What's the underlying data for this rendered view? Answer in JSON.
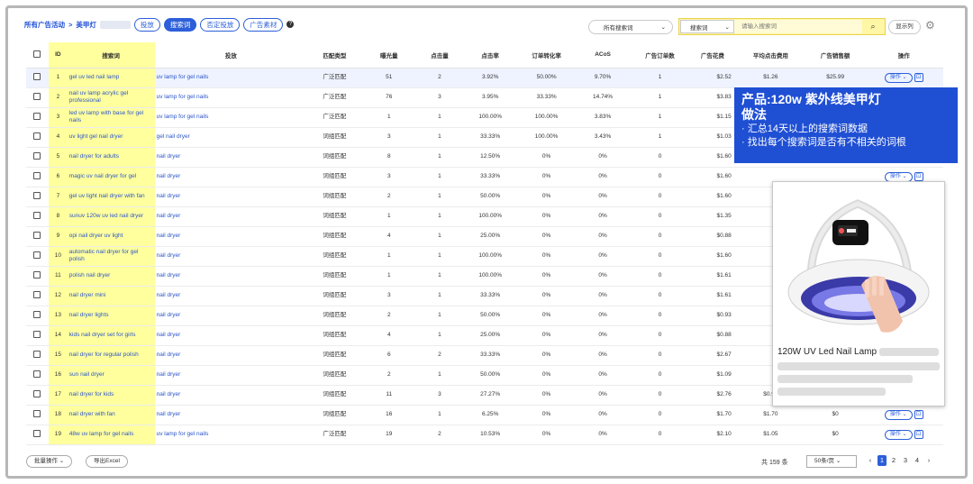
{
  "breadcrumb": {
    "campaigns": "所有广告活动",
    "separator": ">",
    "product": "美甲灯"
  },
  "tabs": [
    {
      "label": "投放",
      "active": false
    },
    {
      "label": "搜索词",
      "active": true
    },
    {
      "label": "否定投放",
      "active": false
    },
    {
      "label": "广告素材",
      "active": false
    }
  ],
  "filter": {
    "search_scope": "所有搜索词"
  },
  "search": {
    "type": "搜索词",
    "placeholder": "请输入搜索词"
  },
  "toolbar": {
    "display_columns": "显示列"
  },
  "table": {
    "headers": [
      "ID",
      "搜索词",
      "投放",
      "匹配类型",
      "曝光量",
      "点击量",
      "点击率",
      "订单转化率",
      "ACoS",
      "广告订单数",
      "广告花费",
      "平均点击费用",
      "广告销售额",
      "操作"
    ],
    "op_label": "操作",
    "rows": [
      {
        "id": "1",
        "kw": "gel uv led nail lamp",
        "target": "uv lamp for gel nails",
        "match": "广泛匹配",
        "imp": "51",
        "clicks": "2",
        "ctr": "3.92%",
        "cvr": "50.00%",
        "acos": "9.70%",
        "orders": "1",
        "spend": "$2.52",
        "cpc": "$1.26",
        "sales": "$25.99"
      },
      {
        "id": "2",
        "kw": "nail uv lamp acrylic gel professional",
        "target": "uv lamp for gel nails",
        "match": "广泛匹配",
        "imp": "76",
        "clicks": "3",
        "ctr": "3.95%",
        "cvr": "33.33%",
        "acos": "14.74%",
        "orders": "1",
        "spend": "$3.83",
        "cpc": "",
        "sales": ""
      },
      {
        "id": "3",
        "kw": "led uv lamp with base for gel nails",
        "target": "uv lamp for gel nails",
        "match": "广泛匹配",
        "imp": "1",
        "clicks": "1",
        "ctr": "100.00%",
        "cvr": "100.00%",
        "acos": "3.83%",
        "orders": "1",
        "spend": "$1.15",
        "cpc": "",
        "sales": ""
      },
      {
        "id": "4",
        "kw": "uv light gel nail dryer",
        "target": "gel nail dryer",
        "match": "词组匹配",
        "imp": "3",
        "clicks": "1",
        "ctr": "33.33%",
        "cvr": "100.00%",
        "acos": "3.43%",
        "orders": "1",
        "spend": "$1.03",
        "cpc": "",
        "sales": ""
      },
      {
        "id": "5",
        "kw": "nail dryer for adults",
        "target": "nail dryer",
        "match": "词组匹配",
        "imp": "8",
        "clicks": "1",
        "ctr": "12.50%",
        "cvr": "0%",
        "acos": "0%",
        "orders": "0",
        "spend": "$1.60",
        "cpc": "$1.60",
        "sales": "$0"
      },
      {
        "id": "6",
        "kw": "magic uv nail dryer for gel",
        "target": "nail dryer",
        "match": "词组匹配",
        "imp": "3",
        "clicks": "1",
        "ctr": "33.33%",
        "cvr": "0%",
        "acos": "0%",
        "orders": "0",
        "spend": "$1.60",
        "cpc": "",
        "sales": ""
      },
      {
        "id": "7",
        "kw": "gel uv light nail dryer with fan",
        "target": "nail dryer",
        "match": "词组匹配",
        "imp": "2",
        "clicks": "1",
        "ctr": "50.00%",
        "cvr": "0%",
        "acos": "0%",
        "orders": "0",
        "spend": "$1.60",
        "cpc": "",
        "sales": ""
      },
      {
        "id": "8",
        "kw": "sunuv 120w uv led nail dryer",
        "target": "nail dryer",
        "match": "词组匹配",
        "imp": "1",
        "clicks": "1",
        "ctr": "100.00%",
        "cvr": "0%",
        "acos": "0%",
        "orders": "0",
        "spend": "$1.35",
        "cpc": "",
        "sales": ""
      },
      {
        "id": "9",
        "kw": "opi nail dryer uv light",
        "target": "nail dryer",
        "match": "词组匹配",
        "imp": "4",
        "clicks": "1",
        "ctr": "25.00%",
        "cvr": "0%",
        "acos": "0%",
        "orders": "0",
        "spend": "$0.88",
        "cpc": "",
        "sales": ""
      },
      {
        "id": "10",
        "kw": "automatic nail dryer for gel polish",
        "target": "nail dryer",
        "match": "词组匹配",
        "imp": "1",
        "clicks": "1",
        "ctr": "100.00%",
        "cvr": "0%",
        "acos": "0%",
        "orders": "0",
        "spend": "$1.60",
        "cpc": "",
        "sales": ""
      },
      {
        "id": "11",
        "kw": "polish nail dryer",
        "target": "nail dryer",
        "match": "词组匹配",
        "imp": "1",
        "clicks": "1",
        "ctr": "100.00%",
        "cvr": "0%",
        "acos": "0%",
        "orders": "0",
        "spend": "$1.61",
        "cpc": "",
        "sales": ""
      },
      {
        "id": "12",
        "kw": "nail dryer mini",
        "target": "nail dryer",
        "match": "词组匹配",
        "imp": "3",
        "clicks": "1",
        "ctr": "33.33%",
        "cvr": "0%",
        "acos": "0%",
        "orders": "0",
        "spend": "$1.61",
        "cpc": "",
        "sales": ""
      },
      {
        "id": "13",
        "kw": "nail dryer lights",
        "target": "nail dryer",
        "match": "词组匹配",
        "imp": "2",
        "clicks": "1",
        "ctr": "50.00%",
        "cvr": "0%",
        "acos": "0%",
        "orders": "0",
        "spend": "$0.93",
        "cpc": "",
        "sales": ""
      },
      {
        "id": "14",
        "kw": "kids nail dryer set for girls",
        "target": "nail dryer",
        "match": "词组匹配",
        "imp": "4",
        "clicks": "1",
        "ctr": "25.00%",
        "cvr": "0%",
        "acos": "0%",
        "orders": "0",
        "spend": "$0.88",
        "cpc": "",
        "sales": ""
      },
      {
        "id": "15",
        "kw": "nail dryer for regular polish",
        "target": "nail dryer",
        "match": "词组匹配",
        "imp": "6",
        "clicks": "2",
        "ctr": "33.33%",
        "cvr": "0%",
        "acos": "0%",
        "orders": "0",
        "spend": "$2.67",
        "cpc": "",
        "sales": ""
      },
      {
        "id": "16",
        "kw": "sun nail dryer",
        "target": "nail dryer",
        "match": "词组匹配",
        "imp": "2",
        "clicks": "1",
        "ctr": "50.00%",
        "cvr": "0%",
        "acos": "0%",
        "orders": "0",
        "spend": "$1.09",
        "cpc": "",
        "sales": ""
      },
      {
        "id": "17",
        "kw": "nail dryer for kids",
        "target": "nail dryer",
        "match": "词组匹配",
        "imp": "11",
        "clicks": "3",
        "ctr": "27.27%",
        "cvr": "0%",
        "acos": "0%",
        "orders": "0",
        "spend": "$2.76",
        "cpc": "$0.92",
        "sales": "$0"
      },
      {
        "id": "18",
        "kw": "nail dryer with fan",
        "target": "nail dryer",
        "match": "词组匹配",
        "imp": "16",
        "clicks": "1",
        "ctr": "6.25%",
        "cvr": "0%",
        "acos": "0%",
        "orders": "0",
        "spend": "$1.70",
        "cpc": "$1.70",
        "sales": "$0"
      },
      {
        "id": "19",
        "kw": "48w uv lamp for gel nails",
        "target": "uv lamp for gel nails",
        "match": "广泛匹配",
        "imp": "19",
        "clicks": "2",
        "ctr": "10.53%",
        "cvr": "0%",
        "acos": "0%",
        "orders": "0",
        "spend": "$2.10",
        "cpc": "$1.05",
        "sales": "$0"
      }
    ]
  },
  "footer": {
    "bulk_action": "批量操作",
    "export": "导出Excel",
    "total": "共 159 条",
    "page_size": "50条/页",
    "pages": [
      "1",
      "2",
      "3",
      "4"
    ],
    "current_page": "1"
  },
  "banner": {
    "line1": "产品:120w 紫外线美甲灯",
    "line2": "做法",
    "item1": "· 汇总14天以上的搜索词数据",
    "item2": "· 找出每个搜索词是否有不相关的词根"
  },
  "product_popup": {
    "title": "120W UV Led Nail Lamp"
  },
  "colors": {
    "accent": "#2c5fd9",
    "highlight": "#ffff9e",
    "banner": "#1f4fd3"
  }
}
